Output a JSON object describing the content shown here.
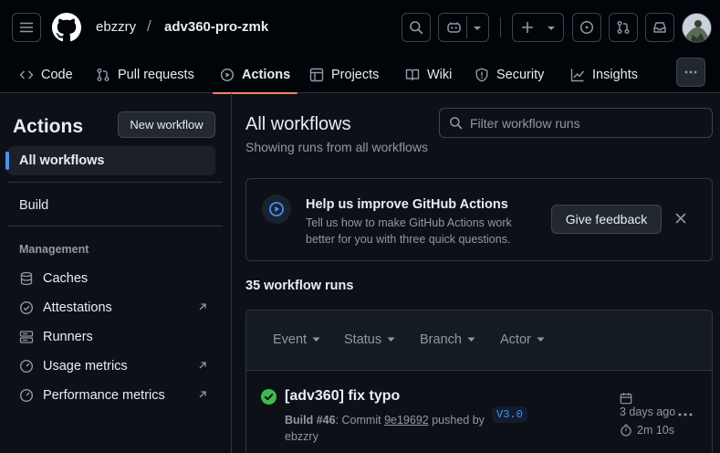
{
  "header": {
    "owner": "ebzzry",
    "separator": "/",
    "repo": "adv360-pro-zmk"
  },
  "tabs": [
    {
      "label": "Code",
      "icon": "code-icon"
    },
    {
      "label": "Pull requests",
      "icon": "git-pull-request-icon"
    },
    {
      "label": "Actions",
      "icon": "play-icon",
      "active": true
    },
    {
      "label": "Projects",
      "icon": "table-icon"
    },
    {
      "label": "Wiki",
      "icon": "book-icon"
    },
    {
      "label": "Security",
      "icon": "shield-icon"
    },
    {
      "label": "Insights",
      "icon": "graph-icon"
    }
  ],
  "sidebar": {
    "title": "Actions",
    "new_workflow": "New workflow",
    "all_workflows": "All workflows",
    "workflows": [
      "Build"
    ],
    "management_heading": "Management",
    "management": [
      {
        "label": "Caches",
        "icon": "database-icon",
        "external": false
      },
      {
        "label": "Attestations",
        "icon": "verified-icon",
        "external": true
      },
      {
        "label": "Runners",
        "icon": "server-icon",
        "external": false
      },
      {
        "label": "Usage metrics",
        "icon": "meter-icon",
        "external": true
      },
      {
        "label": "Performance metrics",
        "icon": "meter-icon",
        "external": true
      }
    ]
  },
  "main": {
    "title": "All workflows",
    "subtitle": "Showing runs from all workflows",
    "filter_placeholder": "Filter workflow runs",
    "banner": {
      "title": "Help us improve GitHub Actions",
      "description": "Tell us how to make GitHub Actions work better for you with three quick questions.",
      "button": "Give feedback"
    },
    "runs_count": "35 workflow runs",
    "filters": [
      "Event",
      "Status",
      "Branch",
      "Actor"
    ],
    "run": {
      "title": "[adv360] fix typo",
      "workflow": "Build #46",
      "commit_prefix": ": Commit ",
      "commit": "9e19692",
      "commit_suffix": " pushed by ebzzry",
      "branch": "V3.0",
      "time": "3 days ago",
      "duration": "2m 10s",
      "status": "success"
    }
  },
  "colors": {
    "accent": "#4493f8",
    "success": "#3fb950",
    "tab_underline": "#f78166"
  }
}
